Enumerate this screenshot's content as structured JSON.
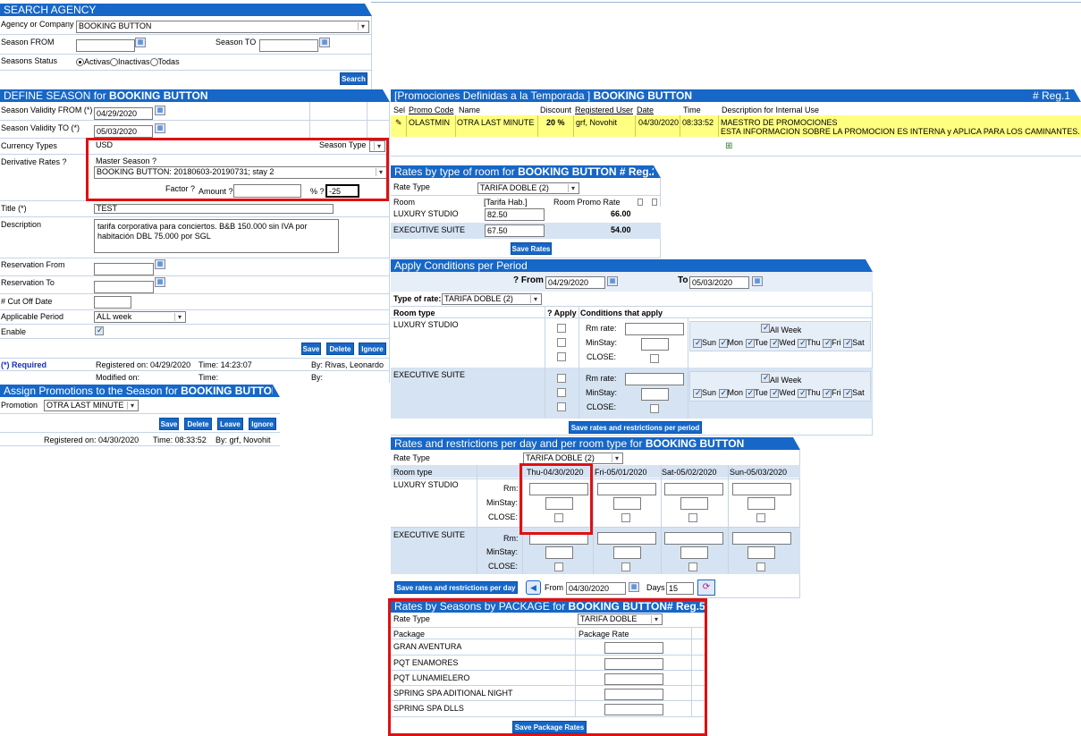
{
  "search": {
    "title": "SEARCH AGENCY",
    "agency_label": "Agency or Company",
    "agency_value": "BOOKING BUTTON",
    "season_from_label": "Season FROM",
    "season_to_label": "Season TO",
    "status_label": "Seasons Status",
    "status_active": "Activas",
    "status_inactive": "Inactivas",
    "status_all": "Todas",
    "search_btn": "Search"
  },
  "define": {
    "title_prefix": "DEFINE SEASON for",
    "title_agency": "BOOKING BUTTON",
    "validity_from_label": "Season Validity FROM (*)",
    "validity_from": "04/29/2020",
    "validity_to_label": "Season Validity TO (*)",
    "validity_to": "05/03/2020",
    "currency_label": "Currency Types",
    "currency": "USD",
    "season_type_label": "Season Type",
    "derivative_label": "Derivative Rates ?",
    "master_season_label": "Master Season ?",
    "master_season_value": "BOOKING BUTTON: 20180603-20190731; stay 2",
    "factor_label": "Factor ?",
    "amount_label": "Amount ?",
    "percent_label": "% ?",
    "percent_value": "-25",
    "title_field_label": "Title (*)",
    "title_value": "TEST",
    "description_label": "Description",
    "description_value": "tarifa corporativa para conciertos. B&B 150.000 sin IVA por habitación DBL 75.000 por SGL",
    "res_from_label": "Reservation From",
    "res_to_label": "Reservation To",
    "cutoff_label": "# Cut Off Date",
    "period_label": "Applicable Period",
    "period_value": "ALL week",
    "enable_label": "Enable",
    "save_btn": "Save",
    "delete_btn": "Delete",
    "ignore_btn": "Ignore",
    "required_note": "(*) Required",
    "registered": "Registered on: 04/29/2020",
    "reg_time": "Time: 14:23:07",
    "reg_by": "By: Rivas, Leonardo",
    "modified": "Modified on:",
    "mod_time": "Time:",
    "mod_by": "By:"
  },
  "assign": {
    "title_prefix": "Assign Promotions to the Season for",
    "title_agency": "BOOKING BUTTON",
    "promotion_label": "Promotion",
    "promotion_value": "OTRA LAST MINUTE",
    "save_btn": "Save",
    "delete_btn": "Delete",
    "leave_btn": "Leave",
    "ignore_btn": "Ignore",
    "registered": "Registered on: 04/30/2020",
    "reg_time": "Time: 08:33:52",
    "reg_by": "By: grf, Novohit"
  },
  "promos": {
    "title_prefix": "[Promociones Definidas a la Temporada ]",
    "title_agency": "BOOKING BUTTON",
    "reg_count": "# Reg.1",
    "columns": [
      "Sel",
      "Promo Code",
      "Name",
      "Discount",
      "Registered User",
      "Date",
      "Time",
      "Description for Internal Use"
    ],
    "row": {
      "code": "OLASTMIN",
      "name": "OTRA LAST MINUTE",
      "discount": "20 %",
      "user": "grf, Novohit",
      "date": "04/30/2020",
      "time": "08:33:52",
      "desc1": "MAESTRO DE PROMOCIONES",
      "desc2": "ESTA INFORMACION SOBRE LA PROMOCION ES INTERNA y APLICA PARA LOS CAMINANTES."
    }
  },
  "rates_room": {
    "title_prefix": "Rates by type of room for",
    "title_agency": "BOOKING BUTTON",
    "reg": "# Reg.2",
    "rate_type_label": "Rate Type",
    "rate_type_value": "TARIFA DOBLE (2)",
    "col_room": "Room",
    "col_tarifa": "[Tarifa Hab.]",
    "col_promo": "Room Promo Rate",
    "rows": [
      {
        "room": "LUXURY STUDIO",
        "rate": "82.50",
        "promo": "66.00"
      },
      {
        "room": "EXECUTIVE SUITE",
        "rate": "67.50",
        "promo": "54.00"
      }
    ],
    "save_btn": "Save Rates"
  },
  "conditions": {
    "title": "Apply Conditions per Period",
    "from_label": "? From",
    "from_value": "04/29/2020",
    "to_label": "To",
    "to_value": "05/03/2020",
    "type_label": "Type of rate:",
    "type_value": "TARIFA DOBLE (2)",
    "col_room": "Room type",
    "col_apply": "? Apply",
    "col_cond": "Conditions that apply",
    "rm_rate": "Rm rate:",
    "min_stay": "MinStay:",
    "close": "CLOSE:",
    "all_week": "All Week",
    "days": [
      "Sun",
      "Mon",
      "Tue",
      "Wed",
      "Thu",
      "Fri",
      "Sat"
    ],
    "rooms": [
      "LUXURY STUDIO",
      "EXECUTIVE SUITE"
    ],
    "save_btn": "Save rates and restrictions per period"
  },
  "perday": {
    "title_prefix": "Rates and restrictions per day and per room type for",
    "title_agency": "BOOKING BUTTON",
    "rate_type_label": "Rate Type",
    "rate_type_value": "TARIFA DOBLE (2)",
    "col_room": "Room type",
    "dates": [
      "Thu-04/30/2020",
      "Fri-05/01/2020",
      "Sat-05/02/2020",
      "Sun-05/03/2020"
    ],
    "rm": "Rm:",
    "min_stay": "MinStay:",
    "close": "CLOSE:",
    "rooms": [
      "LUXURY STUDIO",
      "EXECUTIVE SUITE"
    ],
    "save_btn": "Save rates and restrictions per day",
    "from_label": "From",
    "from_value": "04/30/2020",
    "days_label": "Days",
    "days_value": "15"
  },
  "package": {
    "title_prefix": "Rates by Seasons by PACKAGE for",
    "title_agency": "BOOKING BUTTON# Reg.5",
    "rate_type_label": "Rate Type",
    "rate_type_value": "TARIFA DOBLE",
    "col_package": "Package",
    "col_rate": "Package Rate",
    "packages": [
      "GRAN AVENTURA",
      "PQT ENAMORES",
      "PQT LUNAMIELERO",
      "SPRING SPA ADITIONAL NIGHT",
      "SPRING SPA DLLS"
    ],
    "save_btn": "Save Package Rates"
  }
}
